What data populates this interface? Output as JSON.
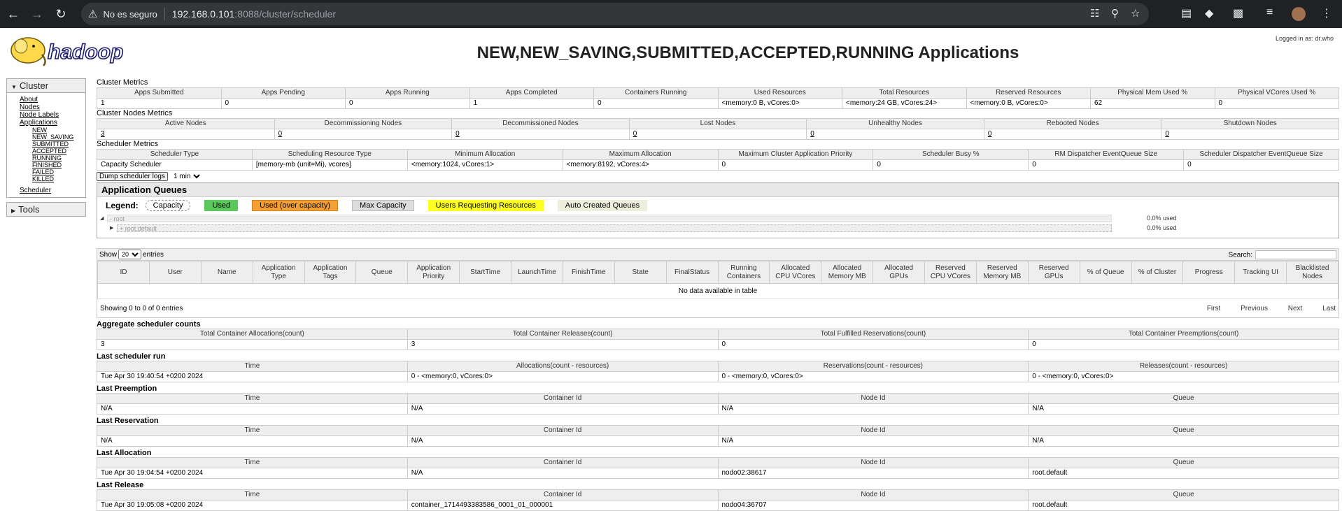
{
  "browser": {
    "security": "No es seguro",
    "host": "192.168.0.101",
    "path": ":8088/cluster/scheduler"
  },
  "header": {
    "title": "NEW,NEW_SAVING,SUBMITTED,ACCEPTED,RUNNING Applications",
    "logged_in": "Logged in as: dr.who",
    "logo_text": "hadoop"
  },
  "nav": {
    "cluster": "Cluster",
    "about": "About",
    "nodes": "Nodes",
    "node_labels": "Node Labels",
    "applications": "Applications",
    "app_states": [
      "NEW",
      "NEW_SAVING",
      "SUBMITTED",
      "ACCEPTED",
      "RUNNING",
      "FINISHED",
      "FAILED",
      "KILLED"
    ],
    "scheduler": "Scheduler",
    "tools": "Tools"
  },
  "cluster_metrics": {
    "title": "Cluster Metrics",
    "headers": [
      "Apps Submitted",
      "Apps Pending",
      "Apps Running",
      "Apps Completed",
      "Containers Running",
      "Used Resources",
      "Total Resources",
      "Reserved Resources",
      "Physical Mem Used %",
      "Physical VCores Used %"
    ],
    "values": [
      "1",
      "0",
      "0",
      "1",
      "0",
      "<memory:0 B, vCores:0>",
      "<memory:24 GB, vCores:24>",
      "<memory:0 B, vCores:0>",
      "62",
      "0"
    ]
  },
  "cluster_nodes_metrics": {
    "title": "Cluster Nodes Metrics",
    "headers": [
      "Active Nodes",
      "Decommissioning Nodes",
      "Decommissioned Nodes",
      "Lost Nodes",
      "Unhealthy Nodes",
      "Rebooted Nodes",
      "Shutdown Nodes"
    ],
    "values": [
      "3",
      "0",
      "0",
      "0",
      "0",
      "0",
      "0"
    ]
  },
  "scheduler_metrics": {
    "title": "Scheduler Metrics",
    "headers": [
      "Scheduler Type",
      "Scheduling Resource Type",
      "Minimum Allocation",
      "Maximum Allocation",
      "Maximum Cluster Application Priority",
      "Scheduler Busy %",
      "RM Dispatcher EventQueue Size",
      "Scheduler Dispatcher EventQueue Size"
    ],
    "values": [
      "Capacity Scheduler",
      "[memory-mb (unit=Mi), vcores]",
      "<memory:1024, vCores:1>",
      "<memory:8192, vCores:4>",
      "0",
      "0",
      "0",
      "0"
    ]
  },
  "dump": {
    "button": "Dump scheduler logs",
    "select": "1 min"
  },
  "queues": {
    "title": "Application Queues",
    "legend_label": "Legend:",
    "legend": [
      "Capacity",
      "Used",
      "Used (over capacity)",
      "Max Capacity",
      "Users Requesting Resources",
      "Auto Created Queues"
    ],
    "root": "root",
    "root_prefix": "-",
    "root_used": "0.0% used",
    "default": "root.default",
    "default_prefix": "+",
    "default_used": "0.0% used"
  },
  "apps": {
    "show": "Show",
    "entries_count": "20",
    "entries": "entries",
    "search": "Search:",
    "headers": [
      "ID",
      "User",
      "Name",
      "Application Type",
      "Application Tags",
      "Queue",
      "Application Priority",
      "StartTime",
      "LaunchTime",
      "FinishTime",
      "State",
      "FinalStatus",
      "Running Containers",
      "Allocated CPU VCores",
      "Allocated Memory MB",
      "Allocated GPUs",
      "Reserved CPU VCores",
      "Reserved Memory MB",
      "Reserved GPUs",
      "% of Queue",
      "% of Cluster",
      "Progress",
      "Tracking UI",
      "Blacklisted Nodes"
    ],
    "empty": "No data available in table",
    "showing": "Showing 0 to 0 of 0 entries",
    "pager": [
      "First",
      "Previous",
      "Next",
      "Last"
    ]
  },
  "aggregate": {
    "title": "Aggregate scheduler counts",
    "headers": [
      "Total Container Allocations(count)",
      "Total Container Releases(count)",
      "Total Fulfilled Reservations(count)",
      "Total Container Preemptions(count)"
    ],
    "values": [
      "3",
      "3",
      "0",
      "0"
    ]
  },
  "last_run": {
    "title": "Last scheduler run",
    "headers": [
      "Time",
      "Allocations(count - resources)",
      "Reservations(count - resources)",
      "Releases(count - resources)"
    ],
    "values": [
      "Tue Apr 30 19:40:54 +0200 2024",
      "0 - <memory:0, vCores:0>",
      "0 - <memory:0, vCores:0>",
      "0 - <memory:0, vCores:0>"
    ]
  },
  "last_preemption": {
    "title": "Last Preemption",
    "headers": [
      "Time",
      "Container Id",
      "Node Id",
      "Queue"
    ],
    "values": [
      "N/A",
      "N/A",
      "N/A",
      "N/A"
    ]
  },
  "last_reservation": {
    "title": "Last Reservation",
    "headers": [
      "Time",
      "Container Id",
      "Node Id",
      "Queue"
    ],
    "values": [
      "N/A",
      "N/A",
      "N/A",
      "N/A"
    ]
  },
  "last_allocation": {
    "title": "Last Allocation",
    "headers": [
      "Time",
      "Container Id",
      "Node Id",
      "Queue"
    ],
    "values": [
      "Tue Apr 30 19:04:54 +0200 2024",
      "N/A",
      "nodo02:38617",
      "root.default"
    ]
  },
  "last_release": {
    "title": "Last Release",
    "headers": [
      "Time",
      "Container Id",
      "Node Id",
      "Queue"
    ],
    "values": [
      "Tue Apr 30 19:05:08 +0200 2024",
      "container_1714493383586_0001_01_000001",
      "nodo04:36707",
      "root.default"
    ]
  }
}
